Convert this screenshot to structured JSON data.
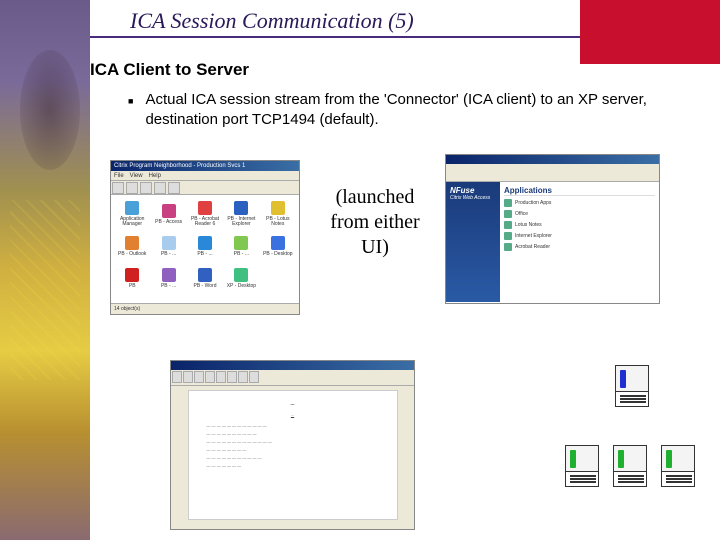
{
  "slide": {
    "title": "ICA Session Communication (5)",
    "subtitle": "ICA Client to Server",
    "bullet": "Actual ICA session stream from the 'Connector' (ICA client) to an XP server, destination port TCP1494 (default).",
    "mid_caption": "(launched from either UI)"
  },
  "pn": {
    "title": "Citrix Program Neighborhood - Production Svcs 1",
    "menu": {
      "file": "File",
      "view": "View",
      "help": "Help"
    },
    "status": "14 object(s)",
    "icons": [
      {
        "label": "Application\\nManager",
        "color": "#4aa0d8"
      },
      {
        "label": "PB - Access",
        "color": "#c84080"
      },
      {
        "label": "PB - Acrobat\\nReader 6",
        "color": "#e04040"
      },
      {
        "label": "PB - Internet\\nExplorer",
        "color": "#2a60c0"
      },
      {
        "label": "PB - Lotus\\nNotes",
        "color": "#e0c030"
      },
      {
        "label": "PB - Outlook",
        "color": "#e08030"
      },
      {
        "label": "PB - ...",
        "color": "#a8ccee"
      },
      {
        "label": "PB - ...",
        "color": "#2a88d8"
      },
      {
        "label": "PB - ...",
        "color": "#80c850"
      },
      {
        "label": "PB - Desktop",
        "color": "#3a70e0"
      },
      {
        "label": "PB",
        "color": "#d02020"
      },
      {
        "label": "PB - ...",
        "color": "#9060c0"
      },
      {
        "label": "PB - Word",
        "color": "#3060c0"
      },
      {
        "label": "XP - Desktop",
        "color": "#40c080"
      }
    ]
  },
  "nfuse": {
    "brand": "NFuse",
    "brand_sub": "Citrix Web Access",
    "apps_heading": "Applications",
    "rows": [
      {
        "label": "Production Apps"
      },
      {
        "label": "Office"
      },
      {
        "label": "Lotus Notes"
      },
      {
        "label": "Internet Explorer"
      },
      {
        "label": "Acrobat Reader"
      }
    ]
  },
  "doc": {
    "heading": "...",
    "subheading": "..."
  }
}
